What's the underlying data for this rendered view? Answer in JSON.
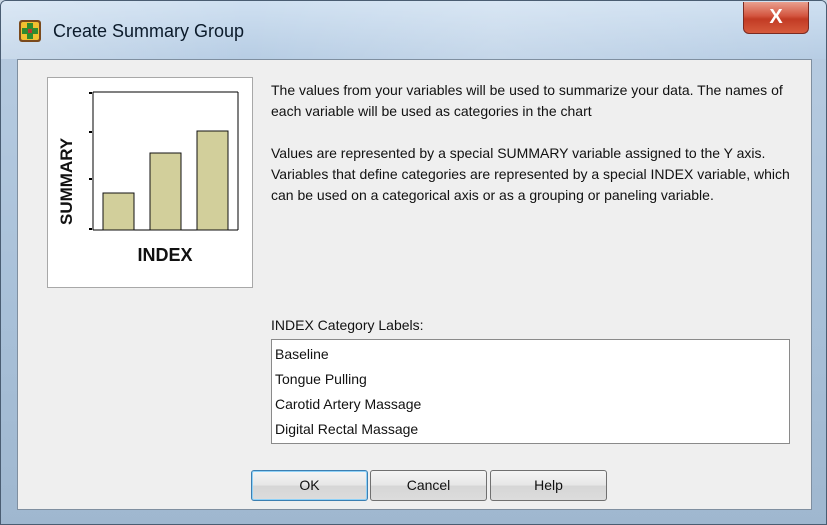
{
  "window": {
    "title": "Create Summary Group",
    "close_label": "X"
  },
  "preview": {
    "y_axis_label": "SUMMARY",
    "x_axis_label": "INDEX",
    "bar_color": "#d2cf9b",
    "bar_levels": [
      0.27,
      0.56,
      0.72
    ]
  },
  "description": {
    "paragraph1": "The values from your variables will be used to summarize your data. The names of each variable will be used as categories in the chart",
    "paragraph2": "Values are represented by a special SUMMARY variable assigned to the Y axis. Variables that define categories are represented by a special INDEX variable, which can be used on a categorical axis or as a grouping or paneling variable."
  },
  "categories": {
    "label": "INDEX Category Labels:",
    "items": [
      "Baseline",
      "Tongue Pulling",
      "Carotid Artery Massage",
      "Digital Rectal Massage"
    ]
  },
  "buttons": {
    "ok": "OK",
    "cancel": "Cancel",
    "help": "Help"
  }
}
